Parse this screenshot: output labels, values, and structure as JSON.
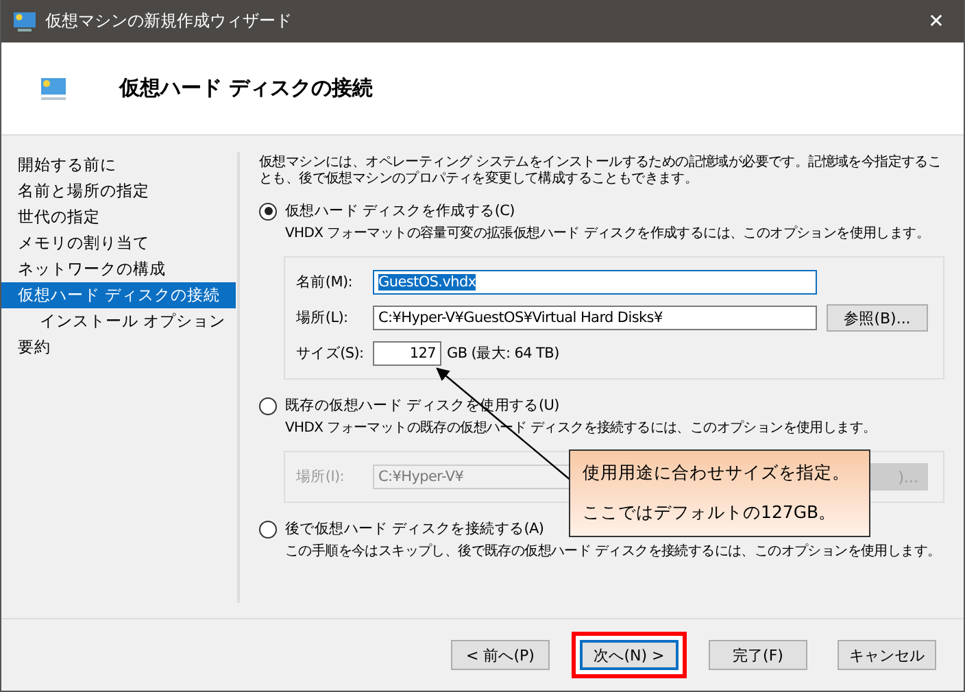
{
  "window": {
    "title": "仮想マシンの新規作成ウィザード",
    "close": "✕"
  },
  "header": {
    "title": "仮想ハード ディスクの接続"
  },
  "sidebar": {
    "items": [
      {
        "label": "開始する前に",
        "selected": false
      },
      {
        "label": "名前と場所の指定",
        "selected": false
      },
      {
        "label": "世代の指定",
        "selected": false
      },
      {
        "label": "メモリの割り当て",
        "selected": false
      },
      {
        "label": "ネットワークの構成",
        "selected": false
      },
      {
        "label": "仮想ハード ディスクの接続",
        "selected": true,
        "children": [
          {
            "label": "インストール オプション",
            "selected": false
          }
        ]
      },
      {
        "label": "要約",
        "selected": false
      }
    ]
  },
  "intro": "仮想マシンには、オペレーティング システムをインストールするための記憶域が必要です。記憶域を今指定することも、後で仮想マシンのプロパティを変更して構成することもできます。",
  "options": [
    {
      "kind": "create",
      "label": "仮想ハード ディスクを作成する(C)",
      "selected": true,
      "description": "VHDX フォーマットの容量可変の拡張仮想ハード ディスクを作成するには、このオプションを使用します。",
      "name_label": "名前(M):",
      "name_value": "GuestOS.vhdx",
      "location_label": "場所(L):",
      "location_value": "C:¥Hyper-V¥GuestOS¥Virtual Hard Disks¥",
      "browse": "参照(B)...",
      "size_label": "サイズ(S):",
      "size_value": "127",
      "size_unit": "GB (最大: 64 TB)"
    },
    {
      "kind": "existing",
      "label": "既存の仮想ハード ディスクを使用する(U)",
      "selected": false,
      "description": "VHDX フォーマットの既存の仮想ハード ディスクを接続するには、このオプションを使用します。",
      "location_label": "場所(I):",
      "location_value": "C:¥Hyper-V¥",
      "browse": ")..."
    },
    {
      "kind": "later",
      "label": "後で仮想ハード ディスクを接続する(A)",
      "selected": false,
      "description": "この手順を今はスキップし、後で既存の仮想ハード ディスクを接続するには、このオプションを使用します。"
    }
  ],
  "callout": {
    "lines": [
      "使用用途に合わせサイズを指定。",
      "ここではデフォルトの127GB。"
    ]
  },
  "buttons": [
    {
      "label": "< 前へ(P)",
      "focused": false,
      "highlighted": false
    },
    {
      "label": "次へ(N) >",
      "focused": true,
      "highlighted": true
    },
    {
      "label": "完了(F)",
      "focused": false,
      "highlighted": false
    },
    {
      "label": "キャンセル",
      "focused": false,
      "highlighted": false
    }
  ]
}
